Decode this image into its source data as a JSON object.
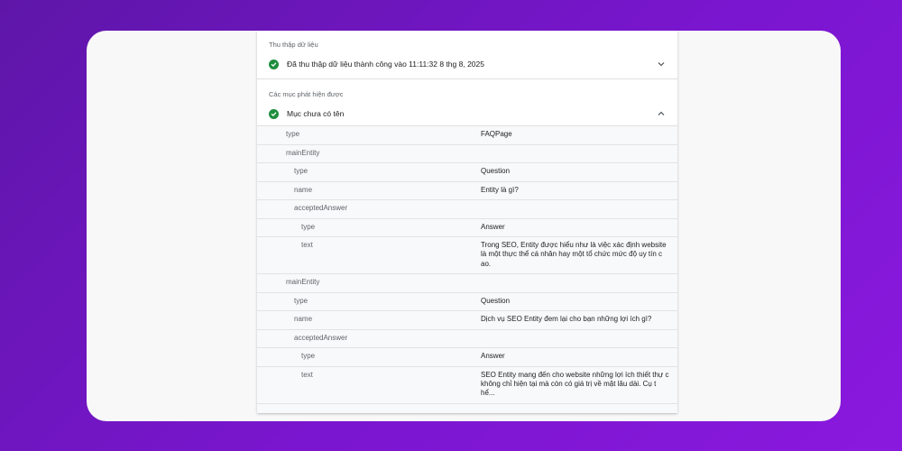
{
  "collection": {
    "label": "Thu thập dữ liệu",
    "status": "Đã thu thập dữ liệu thành công vào 11:11:32 8 thg 8, 2025"
  },
  "detected": {
    "label": "Các mục phát hiện được",
    "item_title": "Mục chưa có tên"
  },
  "rows": [
    {
      "key": "type",
      "value": "FAQPage"
    },
    {
      "key": "mainEntity",
      "value": ""
    },
    {
      "key": "type",
      "value": "Question"
    },
    {
      "key": "name",
      "value": "Entity là gì?"
    },
    {
      "key": "acceptedAnswer",
      "value": ""
    },
    {
      "key": "type",
      "value": "Answer"
    },
    {
      "key": "text",
      "value": "Trong SEO, Entity được hiểu như là việc xác định website là một thực thể cá nhân hay một tổ chức mức độ uy tín c ao."
    },
    {
      "key": "mainEntity",
      "value": ""
    },
    {
      "key": "type",
      "value": "Question"
    },
    {
      "key": "name",
      "value": "Dịch vụ SEO Entity đem lại cho bạn những lợi ích gì?"
    },
    {
      "key": "acceptedAnswer",
      "value": ""
    },
    {
      "key": "type",
      "value": "Answer"
    },
    {
      "key": "text",
      "value": "SEO Entity mang đến cho website những lợi ích thiết thự c không chỉ hiện tại mà còn có giá trị về mặt lâu dài. Cụ t hể..."
    }
  ],
  "colors": {
    "success": "#1e8e3e",
    "background_from": "#5e16a8",
    "background_to": "#8a19de"
  },
  "icons": {
    "status": "check-circle-icon",
    "collapse": "chevron-up-icon",
    "expand": "chevron-down-icon"
  }
}
